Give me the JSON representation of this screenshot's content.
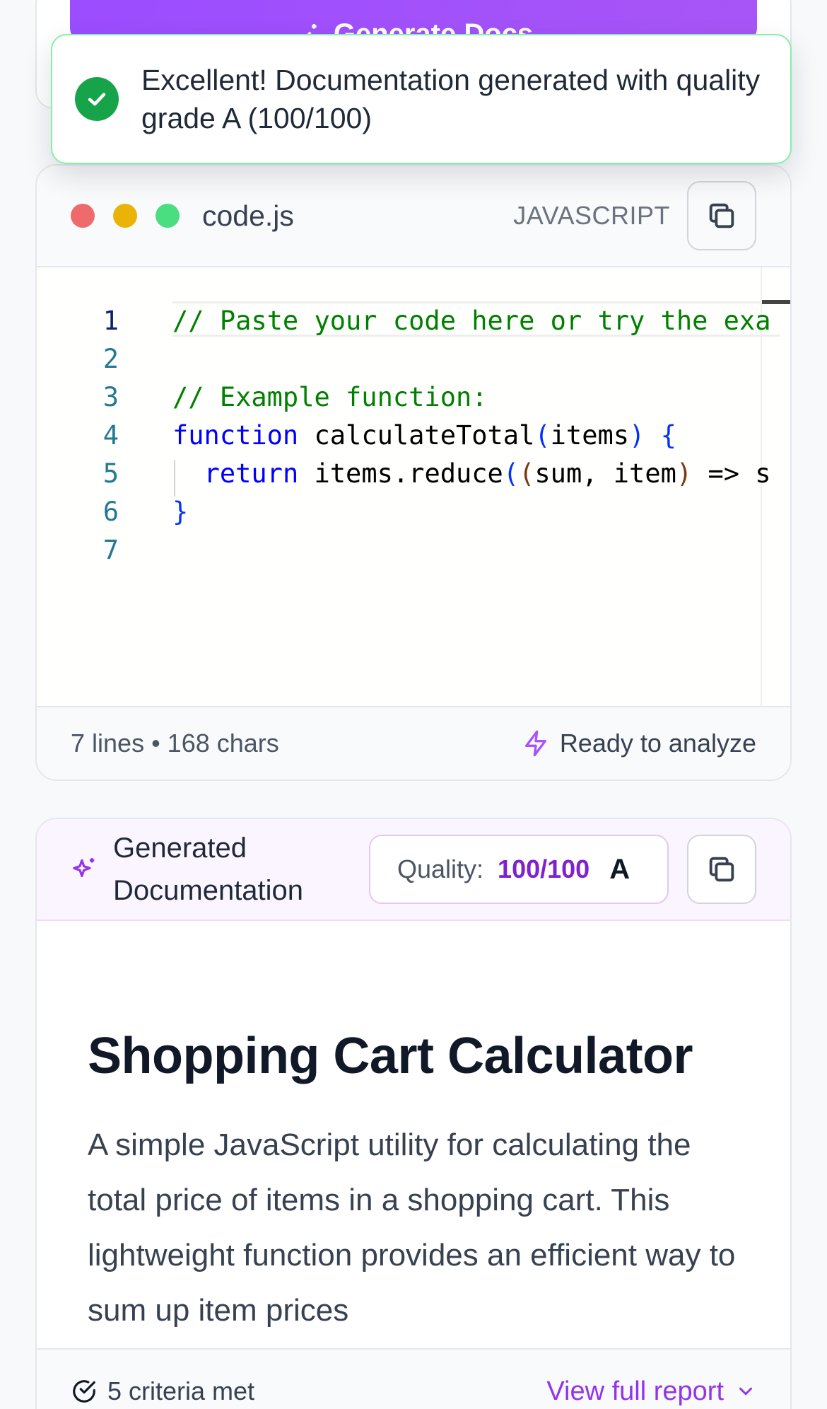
{
  "generate_button": {
    "label": "Generate Docs"
  },
  "toast": {
    "message": "Excellent! Documentation generated with quality grade A (100/100)",
    "icon": "check-circle-icon",
    "accent": "#16a34a"
  },
  "editor": {
    "filename": "code.js",
    "language": "JAVASCRIPT",
    "line_numbers": [
      "1",
      "2",
      "3",
      "4",
      "5",
      "6",
      "7"
    ],
    "lines": [
      "// Paste your code here or try the exa",
      "",
      "// Example function:",
      "function calculateTotal(items) {",
      "  return items.reduce((sum, item) => s",
      "}",
      ""
    ],
    "stats": "7 lines • 168 chars",
    "status": "Ready to analyze"
  },
  "documentation": {
    "title": "Generated Documentation",
    "quality_label": "Quality:",
    "quality_score": "100/100",
    "quality_grade": "A",
    "heading": "Shopping Cart Calculator",
    "paragraph": "A simple JavaScript utility for calculating the total price of items in a shopping cart. This lightweight function provides an efficient way to sum up item prices",
    "criteria": "5 criteria met",
    "report_link": "View full report"
  },
  "colors": {
    "accent_purple": "#9333ea",
    "success_green": "#16a34a",
    "window_red": "#ef6b6b",
    "window_yellow": "#eab308",
    "window_green": "#4ade80"
  }
}
